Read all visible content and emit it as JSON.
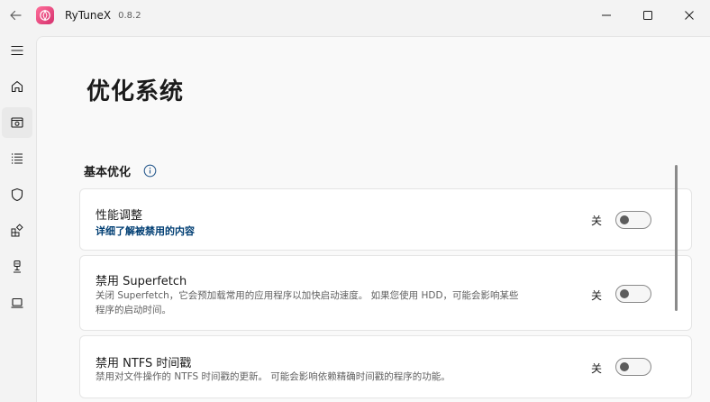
{
  "app": {
    "title": "RyTuneX",
    "version": "0.8.2",
    "accent": "#d4306d"
  },
  "window_controls": [
    "minimize-icon",
    "maximize-icon",
    "close-icon"
  ],
  "sidebar": {
    "items": [
      {
        "name": "menu",
        "icon": "hamburger-menu-icon"
      },
      {
        "name": "home",
        "icon": "home-icon"
      },
      {
        "name": "optimize",
        "icon": "optimize-icon",
        "active": true
      },
      {
        "name": "apps",
        "icon": "list-icon"
      },
      {
        "name": "security",
        "icon": "shield-icon"
      },
      {
        "name": "packages",
        "icon": "apps-add-icon"
      },
      {
        "name": "network",
        "icon": "usb-device-icon"
      },
      {
        "name": "system-info",
        "icon": "laptop-icon"
      }
    ]
  },
  "page": {
    "title": "优化系统",
    "section": {
      "title": "基本优化",
      "icon": "info-icon"
    },
    "cards": [
      {
        "title": "性能调整",
        "link": "详细了解被禁用的内容",
        "toggle_label": "关",
        "toggle_on": false
      },
      {
        "title": "禁用 Superfetch",
        "description_line1": "关闭 Superfetch，它会预加载常用的应用程序以加快启动速度。 如果您使用 HDD，可能会影响某些",
        "description_line2": "程序的启动时间。",
        "toggle_label": "关",
        "toggle_on": false
      },
      {
        "title": "禁用 NTFS 时间戳",
        "description_line1": "禁用对文件操作的 NTFS 时间戳的更新。 可能会影响依赖精确时间戳的程序的功能。",
        "toggle_label": "关",
        "toggle_on": false
      }
    ]
  }
}
